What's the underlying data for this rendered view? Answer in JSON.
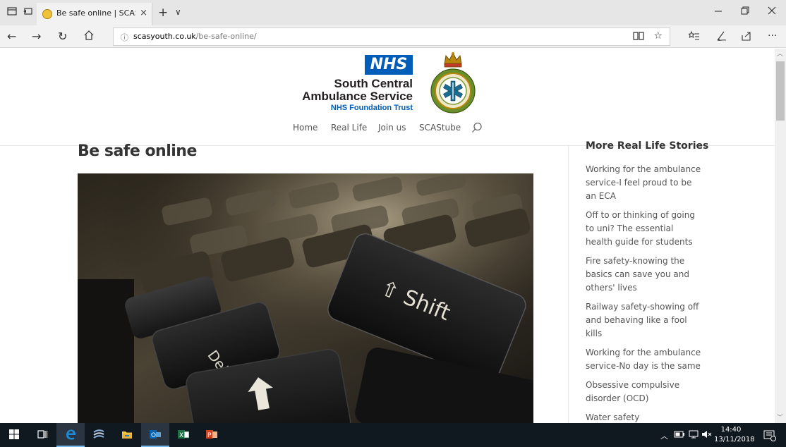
{
  "browser": {
    "tab_title": "Be safe online | SCAS Yc",
    "tab_close": "×",
    "new_tab": "+",
    "tab_dropdown": "∨",
    "url_host": "scasyouth.co.uk",
    "url_path": "/be-safe-online/"
  },
  "header": {
    "nhs_badge": "NHS",
    "org_line1": "South Central",
    "org_line2": "Ambulance Service",
    "org_line3": "NHS Foundation Trust"
  },
  "menu": {
    "items": [
      "Home",
      "Real Life",
      "Join us",
      "SCAStube"
    ]
  },
  "article": {
    "title": "Be safe online",
    "key_labels": {
      "shift": "⇧ Shift",
      "del": "Del"
    }
  },
  "sidebar": {
    "title": "More Real Life Stories",
    "items": [
      "Working for the ambulance service-I feel proud to be an ECA",
      "Off to or thinking of going to uni? The essential health guide for students",
      "Fire safety-knowing the basics can save you and others' lives",
      "Railway safety-showing off and behaving like a fool kills",
      "Working for the ambulance service-No day is the same",
      "Obsessive compulsive disorder (OCD)",
      "Water safety"
    ]
  },
  "taskbar": {
    "time": "14:40",
    "date": "13/11/2018"
  },
  "colors": {
    "nhs_blue": "#005eb8",
    "taskbar": "#101820",
    "edge_blue": "#1e8ad6"
  }
}
